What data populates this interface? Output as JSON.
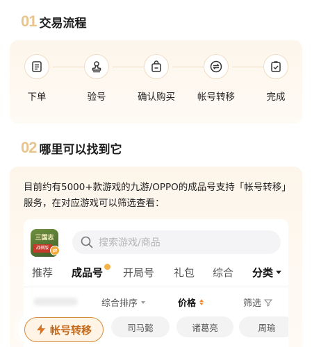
{
  "section1": {
    "num": "01",
    "title": "交易流程"
  },
  "steps": [
    {
      "label": "下单",
      "icon": "document-icon"
    },
    {
      "label": "验号",
      "icon": "stamp-icon"
    },
    {
      "label": "确认购买",
      "icon": "shopping-bag-icon"
    },
    {
      "label": "帐号转移",
      "icon": "transfer-icon"
    },
    {
      "label": "完成",
      "icon": "clipboard-check-icon"
    }
  ],
  "section2": {
    "num": "02",
    "title": "哪里可以找到它"
  },
  "description": "目前约有5000+款游戏的九游/OPPO的成品号支持「帐号转移」服务，在对应游戏可以筛选查看：",
  "app": {
    "game_logo_text": "三国志",
    "game_logo_sub": "战棋版",
    "search_placeholder": "搜索游戏/商品",
    "tabs": [
      "推荐",
      "成品号",
      "开局号",
      "礼包",
      "综合"
    ],
    "active_tab": "成品号",
    "category_label": "分类",
    "sort": {
      "comprehensive": "综合排序",
      "price": "价格",
      "filter": "筛选"
    },
    "chips": [
      "司马懿",
      "诸葛亮",
      "周瑜"
    ],
    "float_button": "帐号转移"
  },
  "colors": {
    "accent": "#e9c48c",
    "orange": "#f08d3a",
    "card_bg": "#fdf6ec"
  }
}
